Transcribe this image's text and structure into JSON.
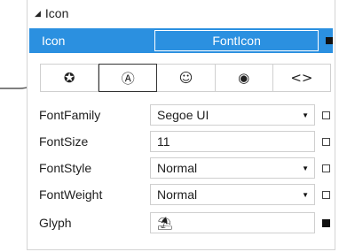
{
  "section": {
    "collapse_glyph": "◢",
    "title": "Icon"
  },
  "icon_row": {
    "name": "Icon",
    "value": "FontIcon"
  },
  "tabs": [
    {
      "icon": "star-circle-icon",
      "glyph": "✪"
    },
    {
      "icon": "letter-a-circle-icon",
      "glyph": "Ⓐ"
    },
    {
      "icon": "emoji-face-icon",
      "glyph": "☺"
    },
    {
      "icon": "globe-circle-icon",
      "glyph": "◉"
    },
    {
      "icon": "code-brackets-icon",
      "glyph": "<>"
    }
  ],
  "properties": [
    {
      "name": "FontFamily",
      "value": "Segoe UI",
      "type": "dropdown"
    },
    {
      "name": "FontSize",
      "value": "11",
      "type": "text"
    },
    {
      "name": "FontStyle",
      "value": "Normal",
      "type": "dropdown"
    },
    {
      "name": "FontWeight",
      "value": "Normal",
      "type": "dropdown"
    },
    {
      "name": "Glyph",
      "value": "⛱",
      "type": "text"
    }
  ]
}
